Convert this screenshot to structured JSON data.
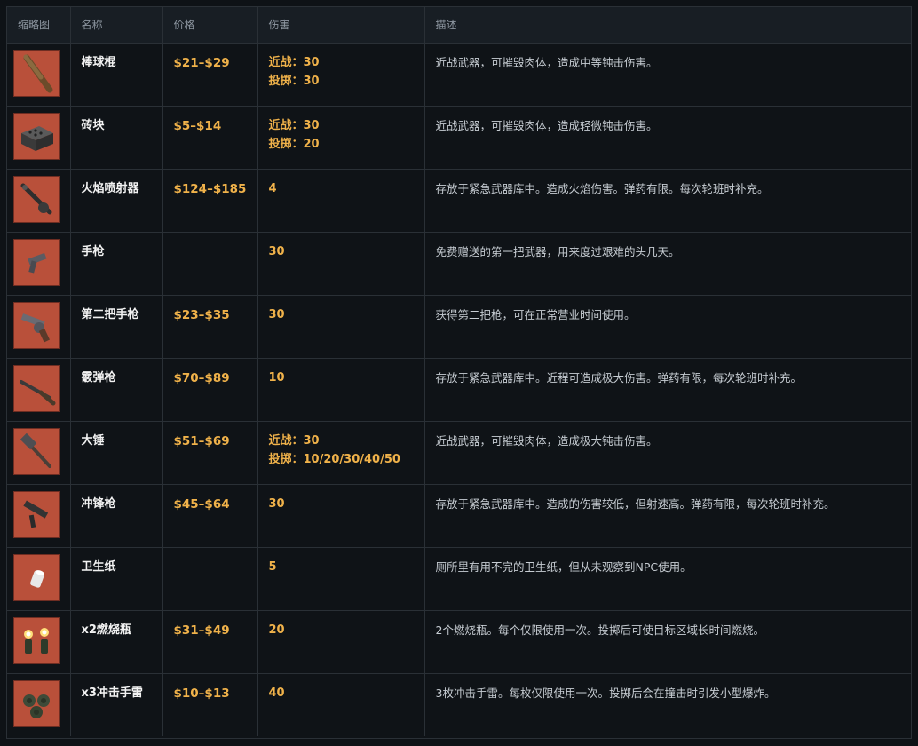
{
  "columns": {
    "thumb": "缩略图",
    "name": "名称",
    "price": "价格",
    "damage": "伤害",
    "desc": "描述"
  },
  "rows": [
    {
      "icon": "baseball-bat-icon",
      "name": "棒球棍",
      "price": "$21–$29",
      "damage": [
        "近战：30",
        "投掷：30"
      ],
      "desc": "近战武器，可摧毁肉体，造成中等钝击伤害。"
    },
    {
      "icon": "brick-icon",
      "name": "砖块",
      "price": "$5–$14",
      "damage": [
        "近战：30",
        "投掷：20"
      ],
      "desc": "近战武器，可摧毁肉体，造成轻微钝击伤害。"
    },
    {
      "icon": "flamethrower-icon",
      "name": "火焰喷射器",
      "price": "$124–$185",
      "damage": [
        "4"
      ],
      "desc": "存放于紧急武器库中。造成火焰伤害。弹药有限。每次轮班时补充。"
    },
    {
      "icon": "pistol-icon",
      "name": "手枪",
      "price": "",
      "damage": [
        "30"
      ],
      "desc": "免费赠送的第一把武器，用来度过艰难的头几天。"
    },
    {
      "icon": "revolver-icon",
      "name": "第二把手枪",
      "price": "$23–$35",
      "damage": [
        "30"
      ],
      "desc": "获得第二把枪，可在正常营业时间使用。"
    },
    {
      "icon": "shotgun-icon",
      "name": "霰弹枪",
      "price": "$70–$89",
      "damage": [
        "10"
      ],
      "desc": "存放于紧急武器库中。近程可造成极大伤害。弹药有限，每次轮班时补充。"
    },
    {
      "icon": "sledgehammer-icon",
      "name": "大锤",
      "price": "$51–$69",
      "damage": [
        "近战：30",
        "投掷：10/20/30/40/50"
      ],
      "desc": "近战武器，可摧毁肉体，造成极大钝击伤害。"
    },
    {
      "icon": "smg-icon",
      "name": "冲锋枪",
      "price": "$45–$64",
      "damage": [
        "30"
      ],
      "desc": "存放于紧急武器库中。造成的伤害较低，但射速高。弹药有限，每次轮班时补充。"
    },
    {
      "icon": "toilet-paper-icon",
      "name": "卫生纸",
      "price": "",
      "damage": [
        "5"
      ],
      "desc": "厕所里有用不完的卫生纸，但从未观察到NPC使用。"
    },
    {
      "icon": "molotov-icon",
      "name": "x2燃烧瓶",
      "price": "$31–$49",
      "damage": [
        "20"
      ],
      "desc": "2个燃烧瓶。每个仅限使用一次。投掷后可使目标区域长时间燃烧。"
    },
    {
      "icon": "grenade-icon",
      "name": "x3冲击手雷",
      "price": "$10–$13",
      "damage": [
        "40"
      ],
      "desc": "3枚冲击手雷。每枚仅限使用一次。投掷后会在撞击时引发小型爆炸。"
    }
  ]
}
